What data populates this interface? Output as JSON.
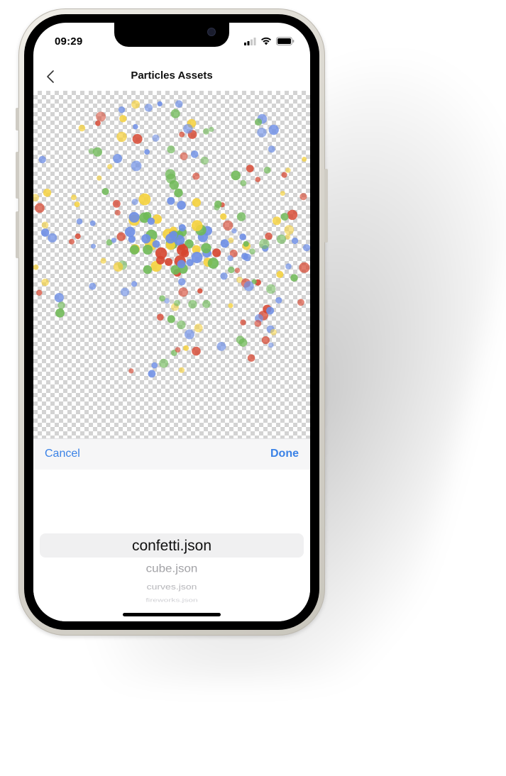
{
  "status": {
    "time": "09:29"
  },
  "nav": {
    "title": "Particles Assets"
  },
  "toolbar": {
    "cancel_label": "Cancel",
    "done_label": "Done"
  },
  "picker": {
    "items": [
      "confetti.json",
      "cube.json",
      "curves.json",
      "fireworks.json"
    ],
    "selected_index": 0
  },
  "colors": {
    "accent": "#3b82e6",
    "particle_red": "#d6452f",
    "particle_yellow": "#f5d13c",
    "particle_green": "#6fb957",
    "particle_blue": "#6d8ee6"
  }
}
